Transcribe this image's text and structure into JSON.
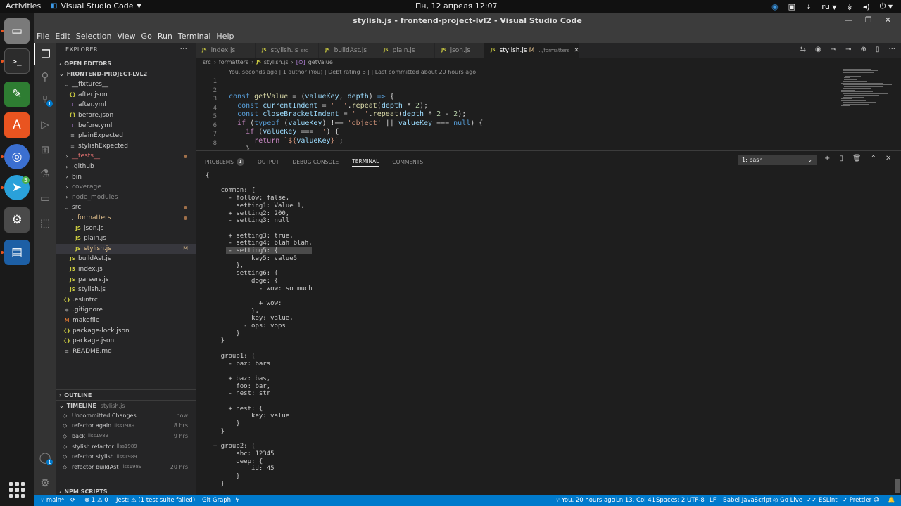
{
  "system": {
    "activities_label": "Activities",
    "app_menu_label": "Visual Studio Code",
    "clock": "Пн, 12 апреля  12:07",
    "language": "ru"
  },
  "window": {
    "title": "stylish.js - frontend-project-lvl2 - Visual Studio Code"
  },
  "menu": [
    "File",
    "Edit",
    "Selection",
    "View",
    "Go",
    "Run",
    "Terminal",
    "Help"
  ],
  "activity_badges": {
    "source_control": "1",
    "accounts": "1"
  },
  "dock_badges": {
    "telegram": "5"
  },
  "sidebar": {
    "header": "EXPLORER",
    "open_editors": "OPEN EDITORS",
    "project": "FRONTEND-PROJECT-LVL2",
    "outline": "OUTLINE",
    "timeline": "TIMELINE",
    "timeline_file": "stylish.js",
    "npm_scripts": "NPM SCRIPTS",
    "tree": [
      {
        "label": "__fixtures__",
        "icon": "chevron-down",
        "indent": 1,
        "kind": "folder"
      },
      {
        "label": "after.json",
        "icon": "{}",
        "indent": 2,
        "kind": "json"
      },
      {
        "label": "after.yml",
        "icon": "!",
        "indent": 2,
        "kind": "yml"
      },
      {
        "label": "before.json",
        "icon": "{}",
        "indent": 2,
        "kind": "json"
      },
      {
        "label": "before.yml",
        "icon": "!",
        "indent": 2,
        "kind": "yml"
      },
      {
        "label": "plainExpected",
        "icon": "≡",
        "indent": 2,
        "kind": "txt"
      },
      {
        "label": "stylishExpected",
        "icon": "≡",
        "indent": 2,
        "kind": "txt"
      },
      {
        "label": "__tests__",
        "icon": "chevron-right",
        "indent": 1,
        "kind": "folder-red",
        "dot": true
      },
      {
        "label": ".github",
        "icon": "chevron-right",
        "indent": 1,
        "kind": "folder"
      },
      {
        "label": "bin",
        "icon": "chevron-right",
        "indent": 1,
        "kind": "folder"
      },
      {
        "label": "coverage",
        "icon": "chevron-right",
        "indent": 1,
        "kind": "folder-dim"
      },
      {
        "label": "node_modules",
        "icon": "chevron-right",
        "indent": 1,
        "kind": "folder-dim"
      },
      {
        "label": "src",
        "icon": "chevron-down",
        "indent": 1,
        "kind": "folder",
        "dot": true
      },
      {
        "label": "formatters",
        "icon": "chevron-down",
        "indent": 2,
        "kind": "folder-mod",
        "dot": true
      },
      {
        "label": "json.js",
        "icon": "JS",
        "indent": 3,
        "kind": "js"
      },
      {
        "label": "plain.js",
        "icon": "JS",
        "indent": 3,
        "kind": "js"
      },
      {
        "label": "stylish.js",
        "icon": "JS",
        "indent": 3,
        "kind": "js-mod",
        "selected": true,
        "flag": "M"
      },
      {
        "label": "buildAst.js",
        "icon": "JS",
        "indent": 2,
        "kind": "js"
      },
      {
        "label": "index.js",
        "icon": "JS",
        "indent": 2,
        "kind": "js"
      },
      {
        "label": "parsers.js",
        "icon": "JS",
        "indent": 2,
        "kind": "js"
      },
      {
        "label": "stylish.js",
        "icon": "JS",
        "indent": 2,
        "kind": "js"
      },
      {
        "label": ".eslintrc",
        "icon": "{}",
        "indent": 1,
        "kind": "json"
      },
      {
        "label": ".gitignore",
        "icon": "◆",
        "indent": 1,
        "kind": "git"
      },
      {
        "label": "makefile",
        "icon": "M",
        "indent": 1,
        "kind": "m"
      },
      {
        "label": "package-lock.json",
        "icon": "{}",
        "indent": 1,
        "kind": "json"
      },
      {
        "label": "package.json",
        "icon": "{}",
        "indent": 1,
        "kind": "json"
      },
      {
        "label": "README.md",
        "icon": "≡",
        "indent": 1,
        "kind": "md"
      }
    ],
    "timeline_items": [
      {
        "label": "Uncommitted Changes",
        "author": "",
        "time": "now"
      },
      {
        "label": "refactor again",
        "author": "llss1989",
        "time": "8 hrs"
      },
      {
        "label": "back",
        "author": "llss1989",
        "time": "9 hrs"
      },
      {
        "label": "stylish refactor",
        "author": "llss1989",
        "time": ""
      },
      {
        "label": "refactor stylish",
        "author": "llss1989",
        "time": ""
      },
      {
        "label": "refactor buildAst",
        "author": "llss1989",
        "time": "20 hrs"
      }
    ]
  },
  "tabs": [
    {
      "label": "index.js",
      "desc": "",
      "active": false
    },
    {
      "label": "stylish.js",
      "desc": "src",
      "active": false
    },
    {
      "label": "buildAst.js",
      "desc": "",
      "active": false
    },
    {
      "label": "plain.js",
      "desc": "",
      "active": false
    },
    {
      "label": "json.js",
      "desc": "",
      "active": false
    },
    {
      "label": "stylish.js",
      "desc": ".../formatters",
      "active": true,
      "modified": "M"
    }
  ],
  "breadcrumb": [
    "src",
    "formatters",
    "stylish.js",
    "getValue"
  ],
  "codelens": "You, seconds ago | 1 author (You) | Debt rating B | | Last committed about 20 hours ago",
  "code_lines": [
    {
      "n": "1",
      "text": "const getValue = (valueKey, depth) => {"
    },
    {
      "n": "2",
      "text": "  const currentIndent = '  '.repeat(depth * 2);"
    },
    {
      "n": "3",
      "text": "  const closeBracketIndent = '  '.repeat(depth * 2 - 2);"
    },
    {
      "n": "4",
      "text": "  if (typeof (valueKey) !== 'object' || valueKey === null) {"
    },
    {
      "n": "5",
      "text": "    if (valueKey === '') {"
    },
    {
      "n": "6",
      "text": "      return `${valueKey}`;"
    },
    {
      "n": "7",
      "text": "    }"
    },
    {
      "n": "8",
      "text": "    return valueKey;"
    }
  ],
  "panel": {
    "tabs": [
      {
        "label": "PROBLEMS",
        "badge": "1"
      },
      {
        "label": "OUTPUT",
        "badge": ""
      },
      {
        "label": "DEBUG CONSOLE",
        "badge": ""
      },
      {
        "label": "TERMINAL",
        "badge": "",
        "active": true
      },
      {
        "label": "COMMENTS",
        "badge": ""
      }
    ],
    "terminal_select": "1: bash"
  },
  "terminal_lines": [
    "{",
    "",
    "    common: {",
    "      - follow: false,",
    "        setting1: Value 1,",
    "      + setting2: 200,",
    "      - setting3: null",
    "",
    "      + setting3: true,",
    "      - setting4: blah blah,",
    "      - setting5: {",
    "            key5: value5",
    "        },",
    "        setting6: {",
    "            doge: {",
    "              - wow: so much",
    "",
    "              + wow:",
    "            },",
    "            key: value,",
    "          - ops: vops",
    "        }",
    "    }",
    "",
    "    group1: {",
    "      - baz: bars",
    "",
    "      + baz: bas,",
    "        foo: bar,",
    "      - nest: str",
    "",
    "      + nest: {",
    "            key: value",
    "        }",
    "    }",
    "",
    "  + group2: {",
    "        abc: 12345",
    "        deep: {",
    "            id: 45",
    "        }",
    "    }"
  ],
  "status": {
    "branch": "main*",
    "errors": "1",
    "warnings": "0",
    "jest": "Jest: ⚠ (1 test suite failed)",
    "git_graph": "Git Graph",
    "blame": "You, 20 hours ago",
    "position": "Ln 13, Col 41",
    "spaces": "Spaces: 2",
    "encoding": "UTF-8",
    "eol": "LF",
    "language": "Babel JavaScript",
    "go_live": "Go Live",
    "eslint": "ESLint",
    "prettier": "Prettier"
  },
  "colors": {
    "statusbar": "#007acc",
    "activitybar": "#333333",
    "sidebar": "#252526",
    "editor": "#1e1e1e",
    "ubuntu_accent": "#e95420"
  }
}
